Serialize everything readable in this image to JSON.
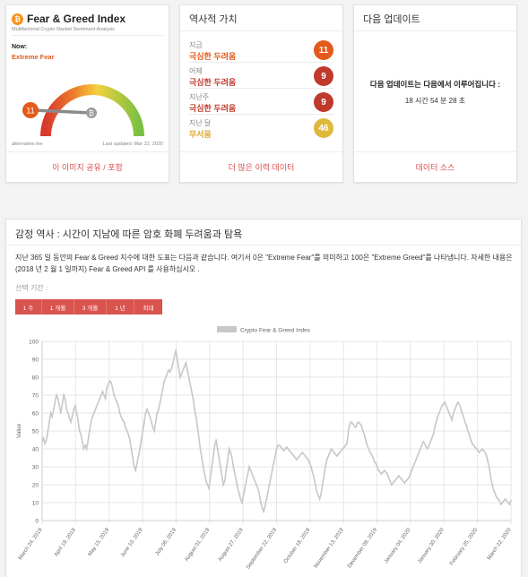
{
  "fng_card": {
    "logo_glyph": "₿",
    "title": "Fear & Greed Index",
    "subtitle": "Multifactorial Crypto Market Sentiment Analysis",
    "now_label": "Now:",
    "now_value": "Extreme Fear",
    "gauge_value": 11,
    "gauge_pointer_glyph": "₿",
    "source": "alternative.me",
    "last_updated": "Last updated: Mar 22, 2020",
    "share_link": "이 이미지 공유 / 포함",
    "colors": {
      "fear": "#e35a1a",
      "greed": "#7ac143",
      "neutral": "#f5d13b"
    }
  },
  "history_card": {
    "title": "역사적 가치",
    "rows": [
      {
        "label": "지금",
        "value": "극심한 두려움",
        "score": "11",
        "color": "#e35a1a"
      },
      {
        "label": "어제",
        "value": "극심한 두려움",
        "score": "9",
        "color": "#c0392b"
      },
      {
        "label": "지난주",
        "value": "극심한 두려움",
        "score": "9",
        "color": "#c0392b"
      },
      {
        "label": "지난 달",
        "value": "무서움",
        "score": "46",
        "color": "#e0b83c"
      }
    ],
    "more_link": "더 많은 이력 데이터"
  },
  "update_card": {
    "title": "다음 업데이트",
    "message": "다음 업데이트는 다음에서 이루어집니다 :",
    "countdown": "18 시간 54 분 28 초",
    "data_source_link": "데이터 소스"
  },
  "trend_panel": {
    "title": "감정 역사 : 시간이 지남에 따른 암호 화폐 두려움과 탐욕",
    "description": "지난 365 일 동안의 Fear & Greed 지수에 대한 도표는 다음과 같습니다. 여기서 0은 \"Extreme Fear\"를 의미하고 100은 \"Extreme Greed\"를 나타냅니다. 자세한 내용은 (2018 년 2 월 1 일까지) Fear & Greed API 를 사용하십시오 .",
    "period_label": "선택 기간 :",
    "periods": [
      "1 주",
      "1 개월",
      "3 개월",
      "1 년",
      "최대"
    ]
  },
  "chart_data": {
    "type": "line",
    "legend": "Crypto Fear & Greed Index",
    "legend_position": "top",
    "ylabel": "Value",
    "xlabel": "",
    "ylim": [
      0,
      100
    ],
    "yticks": [
      0,
      10,
      20,
      30,
      40,
      50,
      60,
      70,
      80,
      90,
      100
    ],
    "grid": true,
    "color": "#c8c8c8",
    "x_ticks": [
      "March 24, 2019",
      "April 19, 2019",
      "May 15, 2019",
      "June 10, 2019",
      "July 06, 2019",
      "August 01, 2019",
      "August 27, 2019",
      "September 22, 2019",
      "October 18, 2019",
      "November 13, 2019",
      "December 09, 2019",
      "January 04, 2020",
      "January 30, 2020",
      "February 25, 2020",
      "March 22, 2020"
    ],
    "values_per_tick_interval": 26,
    "values": [
      44,
      46,
      43,
      45,
      50,
      55,
      60,
      58,
      62,
      66,
      70,
      68,
      64,
      60,
      65,
      70,
      68,
      62,
      60,
      57,
      55,
      58,
      62,
      64,
      60,
      56,
      50,
      48,
      44,
      40,
      42,
      40,
      45,
      50,
      55,
      58,
      60,
      62,
      64,
      66,
      68,
      70,
      72,
      70,
      68,
      74,
      76,
      78,
      77,
      74,
      70,
      68,
      66,
      64,
      60,
      58,
      56,
      55,
      52,
      50,
      48,
      45,
      40,
      35,
      30,
      28,
      32,
      36,
      40,
      45,
      50,
      55,
      60,
      62,
      60,
      58,
      55,
      52,
      50,
      55,
      60,
      62,
      66,
      70,
      74,
      78,
      80,
      82,
      84,
      83,
      85,
      88,
      92,
      95,
      90,
      85,
      80,
      82,
      84,
      86,
      88,
      84,
      80,
      76,
      72,
      68,
      62,
      58,
      52,
      46,
      40,
      35,
      30,
      26,
      22,
      20,
      18,
      24,
      30,
      36,
      42,
      45,
      40,
      35,
      30,
      25,
      20,
      22,
      28,
      34,
      40,
      38,
      35,
      30,
      26,
      22,
      18,
      15,
      12,
      10,
      14,
      18,
      22,
      26,
      30,
      28,
      26,
      24,
      22,
      20,
      18,
      15,
      10,
      7,
      5,
      8,
      12,
      16,
      20,
      24,
      28,
      32,
      36,
      40,
      42,
      42,
      41,
      40,
      39,
      40,
      41,
      40,
      39,
      38,
      37,
      36,
      35,
      34,
      35,
      36,
      37,
      38,
      37,
      36,
      35,
      34,
      32,
      30,
      27,
      24,
      20,
      16,
      14,
      12,
      15,
      20,
      25,
      30,
      34,
      36,
      38,
      40,
      39,
      38,
      37,
      36,
      37,
      38,
      39,
      40,
      41,
      42,
      43,
      50,
      54,
      55,
      54,
      53,
      52,
      54,
      55,
      54,
      53,
      50,
      48,
      45,
      42,
      40,
      38,
      37,
      35,
      33,
      32,
      30,
      28,
      27,
      26,
      27,
      28,
      27,
      26,
      24,
      22,
      20,
      21,
      22,
      23,
      24,
      25,
      24,
      23,
      22,
      21,
      22,
      23,
      24,
      26,
      28,
      30,
      32,
      34,
      36,
      38,
      40,
      42,
      44,
      43,
      41,
      40,
      42,
      44,
      46,
      48,
      52,
      55,
      58,
      60,
      62,
      64,
      65,
      66,
      64,
      62,
      60,
      58,
      56,
      60,
      62,
      64,
      66,
      65,
      63,
      60,
      58,
      55,
      53,
      50,
      48,
      45,
      43,
      42,
      41,
      40,
      39,
      38,
      39,
      40,
      39,
      38,
      36,
      33,
      29,
      24,
      20,
      17,
      15,
      13,
      12,
      11,
      9,
      10,
      11,
      12,
      11,
      10,
      9,
      11
    ]
  }
}
